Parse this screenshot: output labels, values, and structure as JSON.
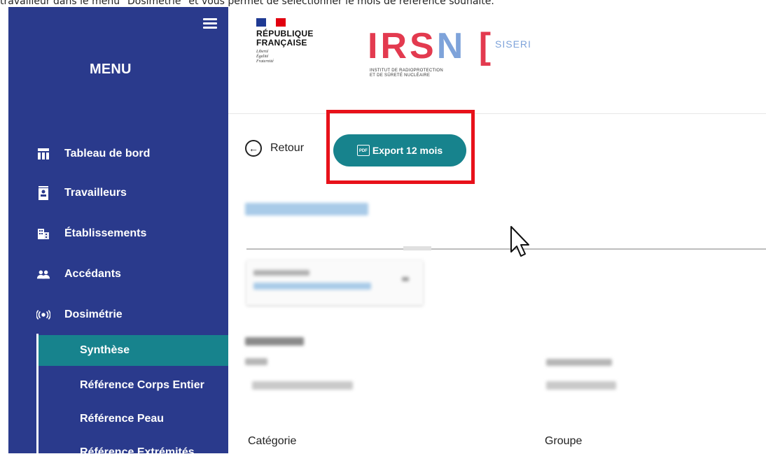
{
  "caption": "travailleur dans le menu \"Dosimétrie\" et vous permet de sélectionner le mois de référence souhaité.",
  "sidebar": {
    "title": "MENU",
    "items": [
      {
        "label": "Tableau de bord",
        "icon": "dashboard-icon"
      },
      {
        "label": "Travailleurs",
        "icon": "worker-badge-icon"
      },
      {
        "label": "Établissements",
        "icon": "building-icon"
      },
      {
        "label": "Accédants",
        "icon": "people-icon"
      },
      {
        "label": "Dosimétrie",
        "icon": "radiation-signal-icon"
      }
    ],
    "subitems": [
      {
        "label": "Synthèse",
        "active": true
      },
      {
        "label": "Référence Corps Entier",
        "active": false
      },
      {
        "label": "Référence Peau",
        "active": false
      },
      {
        "label": "Référence Extrémités",
        "active": false
      }
    ]
  },
  "header": {
    "republique": [
      "RÉPUBLIQUE",
      "FRANÇAISE"
    ],
    "motto": [
      "Liberté",
      "Égalité",
      "Fraternité"
    ],
    "irsn": "IRSN",
    "siseri": "SISERI",
    "irsn_subtitle": [
      "INSTITUT DE RADIOPROTECTION",
      "ET DE SÛRETÉ NUCLÉAIRE"
    ]
  },
  "toolbar": {
    "back_label": "Retour",
    "export_label": "Export 12 mois",
    "pdf_icon_text": "PDF"
  },
  "fields": {
    "categorie_label": "Catégorie",
    "groupe_label": "Groupe"
  },
  "colors": {
    "sidebar_bg": "#2a3a8c",
    "accent_teal": "#17838d",
    "irsn_red": "#e33a4f",
    "highlight_red": "#e8111a"
  }
}
